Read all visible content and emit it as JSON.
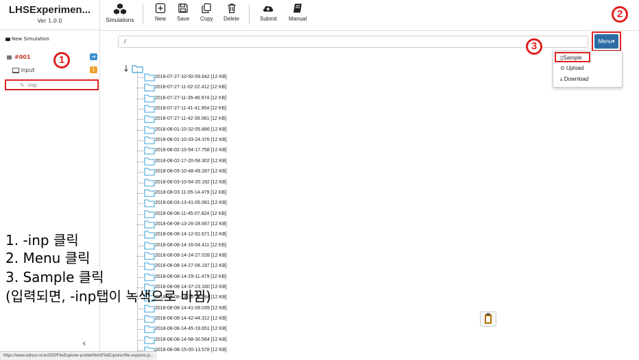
{
  "app": {
    "title": "LHSExperimen...",
    "version": "Ver 1.0.0"
  },
  "toolbar": {
    "simulations": "Simulations",
    "new": "New",
    "save": "Save",
    "copy": "Copy",
    "delete": "Delete",
    "submit": "Submit",
    "manual": "Manual"
  },
  "sidebar": {
    "new_simulation": "New Simulation",
    "sim_id": "#001",
    "input_label": "input",
    "inp_label": "-inp",
    "input_badge": "1",
    "collapse": "‹"
  },
  "path": "/",
  "menu": {
    "button": "Menu▾",
    "items": [
      "Sample",
      "Upload",
      "Download"
    ]
  },
  "tree": {
    "items": [
      "2018-07-27-10-50-59.642 [12 KB]",
      "2018-07-27-11-02-22.412 [12 KB]",
      "2018-07-27-11-35-46.974 [12 KB]",
      "2018-07-27-11-41-41.954 [12 KB]",
      "2018-07-27-11-42-39.081 [12 KB]",
      "2018-08-01-10-32-05.866 [12 KB]",
      "2018-08-01-10-33-24.376 [12 KB]",
      "2018-08-02-10-54-17.758 [12 KB]",
      "2018-08-02-17-20-58.302 [12 KB]",
      "2018-08-03-10-48-49.287 [12 KB]",
      "2018-08-03-10-54-20.192 [12 KB]",
      "2018-08-03-11-05-14.479 [12 KB]",
      "2018-08-03-13-41-05.061 [12 KB]",
      "2018-08-08-11-45-07.824 [12 KB]",
      "2018-08-08-13-26-28.667 [12 KB]",
      "2018-08-08-14-12-02.671 [12 KB]",
      "2018-08-08-14-16-04.411 [12 KB]",
      "2018-08-08-14-24-27.028 [12 KB]",
      "2018-08-08-14-27-06.197 [12 KB]",
      "2018-08-08-14-29-11.479 [12 KB]",
      "2018-08-08-14-37-23.160 [12 KB]",
      "2018-08-08-14-38-38.584 [12 KB]",
      "2018-08-08-14-41-09.039 [12 KB]",
      "2018-08-08-14-42-44.312 [12 KB]",
      "2018-08-08-14-45-19.651 [12 KB]",
      "2018-08-08-14-58-30.564 [12 KB]",
      "2018-08-08-15-00-13.578 [12 KB]"
    ]
  },
  "annotations": {
    "markers": [
      "1",
      "2",
      "3"
    ],
    "lines": [
      "1. -inp 클릭",
      "2. Menu 클릭",
      "3. Sample 클릭",
      "(입력되면, -inp탭이 녹색으로 바뀜)"
    ]
  },
  "status_url": "https://www.edison.re.kr/OSPFileExplorer-portlet/html/FileExplorer/file-explorer.js...",
  "colors": {
    "highlight": "#e02020",
    "menu_button": "#2e6da4",
    "folder": "#3ea0d8",
    "badge_blue": "#3a8fd0",
    "badge_orange": "#f0a030"
  }
}
